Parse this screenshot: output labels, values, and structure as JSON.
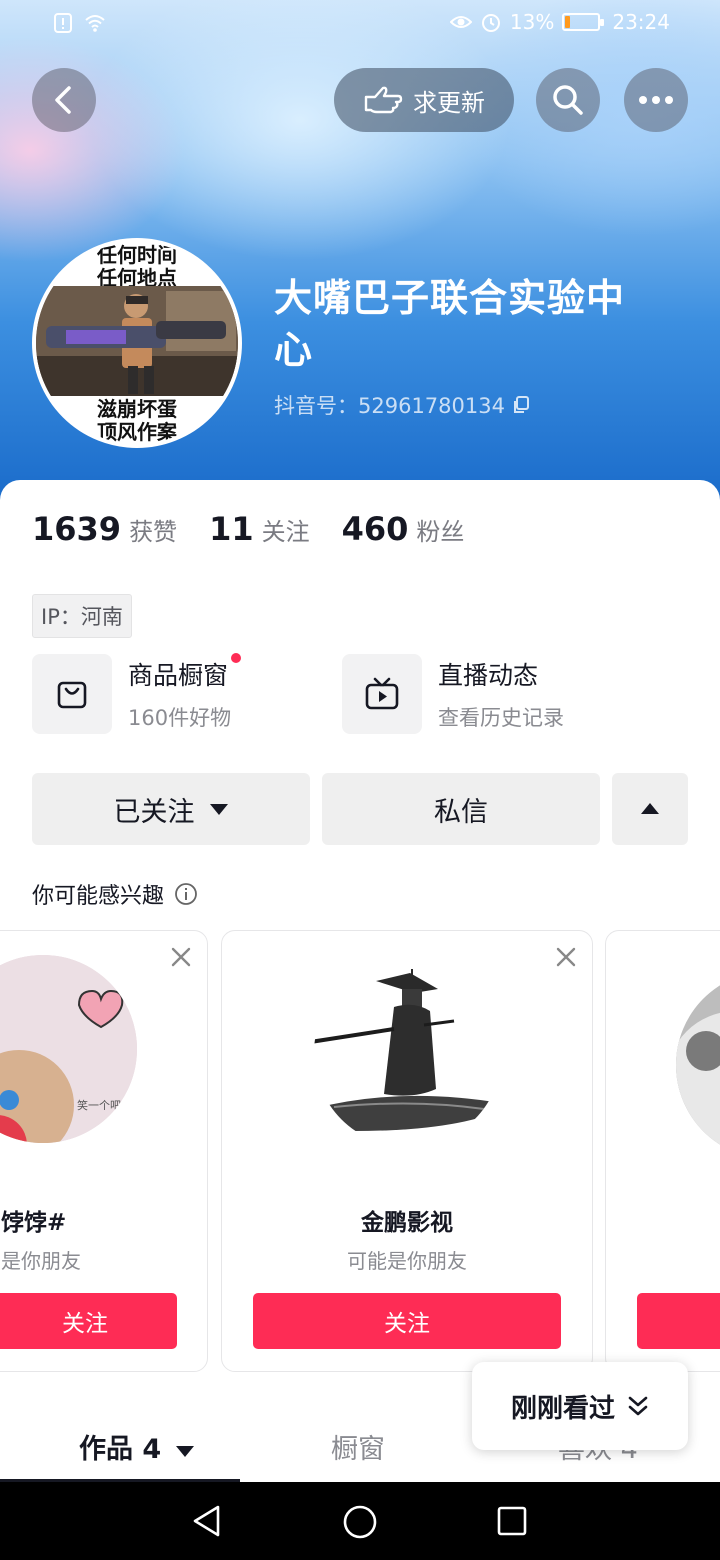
{
  "status_bar": {
    "battery_percent": "13%",
    "battery_level": 0.13,
    "time": "23:24"
  },
  "header": {
    "back_icon": "chevron-left-icon",
    "update_button_label": "求更新",
    "update_icon": "pointing-hand-icon",
    "search_icon": "search-icon",
    "more_icon": "more-dots-icon"
  },
  "profile": {
    "avatar_text_top": [
      "任何时间",
      "任何地点"
    ],
    "avatar_text_bottom": [
      "滋崩坏蛋",
      "顶风作案"
    ],
    "username_line1": "大嘴巴子联合实验中",
    "username_line2": "心",
    "douyin_id": "抖音号：52961780134"
  },
  "stats": [
    {
      "value": "1639",
      "label": "获赞"
    },
    {
      "value": "11",
      "label": "关注"
    },
    {
      "value": "460",
      "label": "粉丝"
    }
  ],
  "ip_tag": "IP：河南",
  "features": [
    {
      "title": "商品橱窗",
      "subtitle": "160件好物",
      "icon": "shopping-bag-icon",
      "has_dot": true
    },
    {
      "title": "直播动态",
      "subtitle": "查看历史记录",
      "icon": "tv-play-icon",
      "has_dot": false
    }
  ],
  "actions": {
    "followed_label": "已关注",
    "message_label": "私信"
  },
  "interest": {
    "title": "你可能感兴趣"
  },
  "recommendations": [
    {
      "name": "饽饽#",
      "subtitle": "是你朋友",
      "follow_label": "关注",
      "avatar_text": "笑一个吧"
    },
    {
      "name": "金鹏影视",
      "subtitle": "可能是你朋友",
      "follow_label": "关注"
    },
    {
      "name": "",
      "subtitle": "",
      "follow_label": ""
    }
  ],
  "tabs": [
    {
      "label": "作品 4",
      "active": true
    },
    {
      "label": "橱窗",
      "active": false
    },
    {
      "label": "喜欢 4",
      "active": false
    }
  ],
  "just_viewed": {
    "label": "刚刚看过"
  },
  "colors": {
    "accent": "#fe2c55",
    "header_blue": "#1768c8",
    "text": "#161823"
  }
}
